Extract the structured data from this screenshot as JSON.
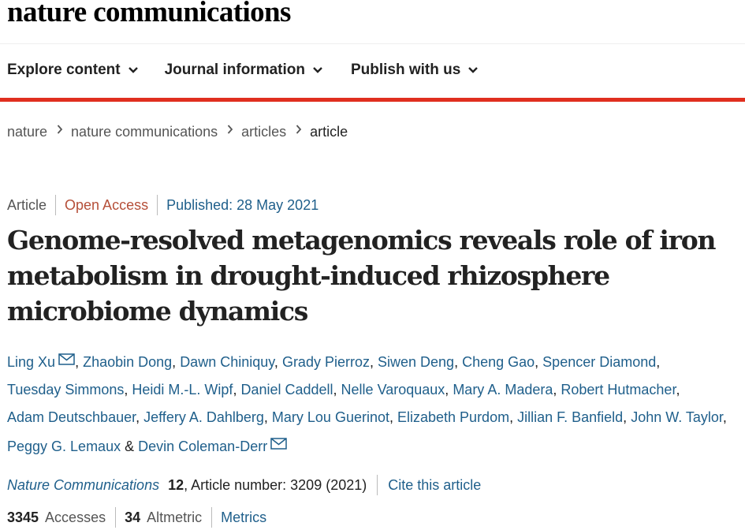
{
  "site": {
    "brand": "nature communications"
  },
  "nav": {
    "items": [
      {
        "label": "Explore content"
      },
      {
        "label": "Journal information"
      },
      {
        "label": "Publish with us"
      }
    ]
  },
  "colors": {
    "accent_bar": "#e02f1f",
    "link": "#1f5f8b",
    "open_access": "#b54f39"
  },
  "breadcrumb": [
    "nature",
    "nature communications",
    "articles",
    "article"
  ],
  "article": {
    "type": "Article",
    "access": "Open Access",
    "published": "Published: 28 May 2021",
    "title": "Genome-resolved metagenomics reveals role of iron metabolism in drought-induced rhizosphere microbiome dynamics",
    "authors": [
      "Ling Xu",
      "Zhaobin Dong",
      "Dawn Chiniquy",
      "Grady Pierroz",
      "Siwen Deng",
      "Cheng Gao",
      "Spencer Diamond",
      "Tuesday Simmons",
      "Heidi M.-L. Wipf",
      "Daniel Caddell",
      "Nelle Varoquaux",
      "Mary A. Madera",
      "Robert Hutmacher",
      "Adam Deutschbauer",
      "Jeffery A. Dahlberg",
      "Mary Lou Guerinot",
      "Elizabeth Purdom",
      "Jillian F. Banfield",
      "John W. Taylor",
      "Peggy G. Lemaux",
      "Devin Coleman-Derr"
    ],
    "author_join": "&",
    "journal": "Nature Communications",
    "volume": "12",
    "article_number": ", Article number: 3209 (2021)",
    "cite_label": "Cite this article",
    "accesses_count": "3345",
    "accesses_label": "Accesses",
    "altmetric_count": "34",
    "altmetric_label": "Altmetric",
    "metrics_label": "Metrics"
  }
}
